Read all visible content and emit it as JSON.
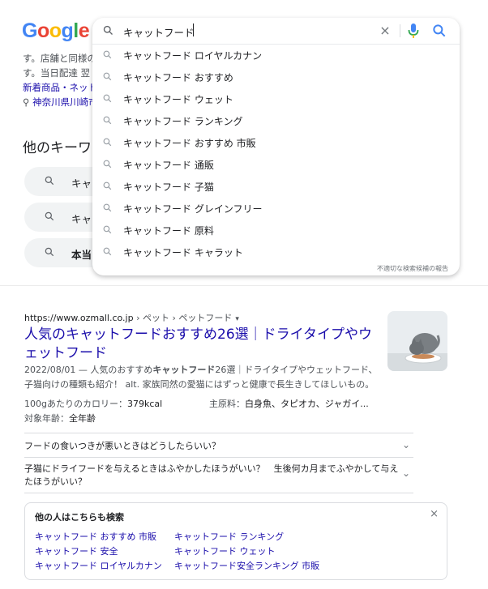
{
  "logo": "Google",
  "colors": {
    "blue": "#4285F4",
    "red": "#EA4335",
    "yellow": "#FBBC05",
    "green": "#34A853",
    "link": "#1a0dab"
  },
  "search": {
    "value": "キャットフード",
    "clear_icon": "×"
  },
  "suggestions": [
    "キャットフード ロイヤルカナン",
    "キャットフード おすすめ",
    "キャットフード ウェット",
    "キャットフード ランキング",
    "キャットフード おすすめ 市販",
    "キャットフード 通販",
    "キャットフード 子猫",
    "キャットフード グレインフリー",
    "キャットフード 原料",
    "キャットフード キャラット"
  ],
  "report_text": "不適切な検索候補の報告",
  "background": {
    "line1": "す。店舗と同様の",
    "line2": "す。当日配達 翌",
    "links": "新着商品・ネット",
    "location": "神奈川県川崎市",
    "other_keywords": "他のキーワード",
    "pills": [
      "キャ",
      "キャ",
      "本当"
    ]
  },
  "result": {
    "url": "https://www.ozmall.co.jp",
    "breadcrumb": " › ペット › ペットフード",
    "dropdown": "▾",
    "title": "人気のキャットフードおすすめ26選｜ドライタイプやウェットフード",
    "snippet_date": "2022/08/01 — 人気のおすすめ",
    "snippet_bold": "キャットフード",
    "snippet_rest": "26選｜ドライタイプやウェットフード、子猫向けの種類も紹介！ alt. 家族同然の愛猫にはずっと健康で長生きしてほしいもの。",
    "attrs": [
      {
        "label": "100gあたりのカロリー：",
        "value": "379kcal"
      },
      {
        "label": "主原料：",
        "value": "白身魚、タピオカ、ジャガイ..."
      },
      {
        "label": "対象年齢：",
        "value": "全年齢"
      }
    ]
  },
  "faqs": [
    "フードの食いつきが悪いときはどうしたらいい？",
    "子猫にドライフードを与えるときはふやかしたほうがいい？　生後何カ月までふやかして与えたほうがいい？"
  ],
  "also_search": {
    "title": "他の人はこちらも検索",
    "close": "×",
    "links": [
      "キャットフード おすすめ 市販",
      "キャットフード ランキング",
      "キャットフード 安全",
      "キャットフード ウェット",
      "キャットフード ロイヤルカナン",
      "キャットフード安全ランキング 市販"
    ]
  }
}
